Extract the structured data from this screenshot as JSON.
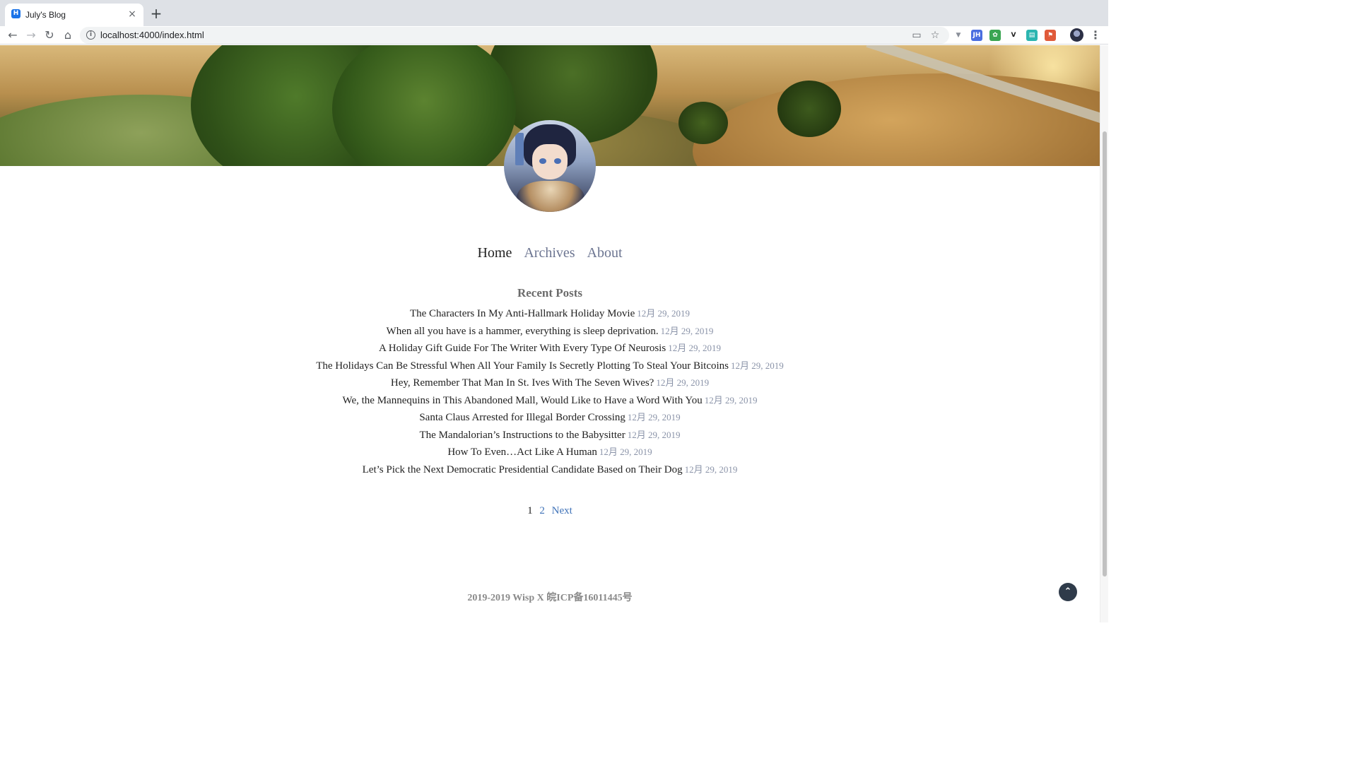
{
  "browser": {
    "tab_title": "July's Blog",
    "tab_favicon": "H",
    "tab_close_icon": "×",
    "new_tab_icon": "+",
    "url": "localhost:4000/index.html",
    "icons": {
      "back": "←",
      "forward": "→",
      "reload": "↻",
      "home": "⌂",
      "info": "i",
      "cast": "▭",
      "bookmark": "☆",
      "menu": "⋮"
    },
    "extensions": [
      {
        "name": "vue-devtools-icon",
        "label": "▼",
        "color": "#8a8f99"
      },
      {
        "name": "jh-extension-icon",
        "label": "JH",
        "color": "#4a6ee0"
      },
      {
        "name": "paw-extension-icon",
        "label": "✿",
        "color": "#3aa552"
      },
      {
        "name": "v-extension-icon",
        "label": "V",
        "color": "#1f1f1f"
      },
      {
        "name": "teal-extension-icon",
        "label": "▤",
        "color": "#2bb5b0"
      },
      {
        "name": "red-extension-icon",
        "label": "⚑",
        "color": "#e05a3a"
      }
    ]
  },
  "page": {
    "nav": {
      "home": "Home",
      "archives": "Archives",
      "about": "About"
    },
    "recent_title": "Recent Posts",
    "posts": [
      {
        "title": "The Characters In My Anti-Hallmark Holiday Movie",
        "date": "12月 29, 2019"
      },
      {
        "title": "When all you have is a hammer, everything is sleep deprivation.",
        "date": "12月 29, 2019"
      },
      {
        "title": "A Holiday Gift Guide For The Writer With Every Type Of Neurosis",
        "date": "12月 29, 2019"
      },
      {
        "title": "The Holidays Can Be Stressful When All Your Family Is Secretly Plotting To Steal Your Bitcoins",
        "date": "12月 29, 2019"
      },
      {
        "title": "Hey, Remember That Man In St. Ives With The Seven Wives?",
        "date": "12月 29, 2019"
      },
      {
        "title": "We, the Mannequins in This Abandoned Mall, Would Like to Have a Word With You",
        "date": "12月 29, 2019"
      },
      {
        "title": "Santa Claus Arrested for Illegal Border Crossing",
        "date": "12月 29, 2019"
      },
      {
        "title": "The Mandalorian’s Instructions to the Babysitter",
        "date": "12月 29, 2019"
      },
      {
        "title": "How To Even…Act Like A Human",
        "date": "12月 29, 2019"
      },
      {
        "title": "Let’s Pick the Next Democratic Presidential Candidate Based on Their Dog",
        "date": "12月 29, 2019"
      }
    ],
    "pager": {
      "current": "1",
      "page2": "2",
      "next": "Next"
    },
    "footer": "2019-2019 Wisp X 皖ICP备16011445号",
    "back_to_top_icon": "⌃"
  }
}
